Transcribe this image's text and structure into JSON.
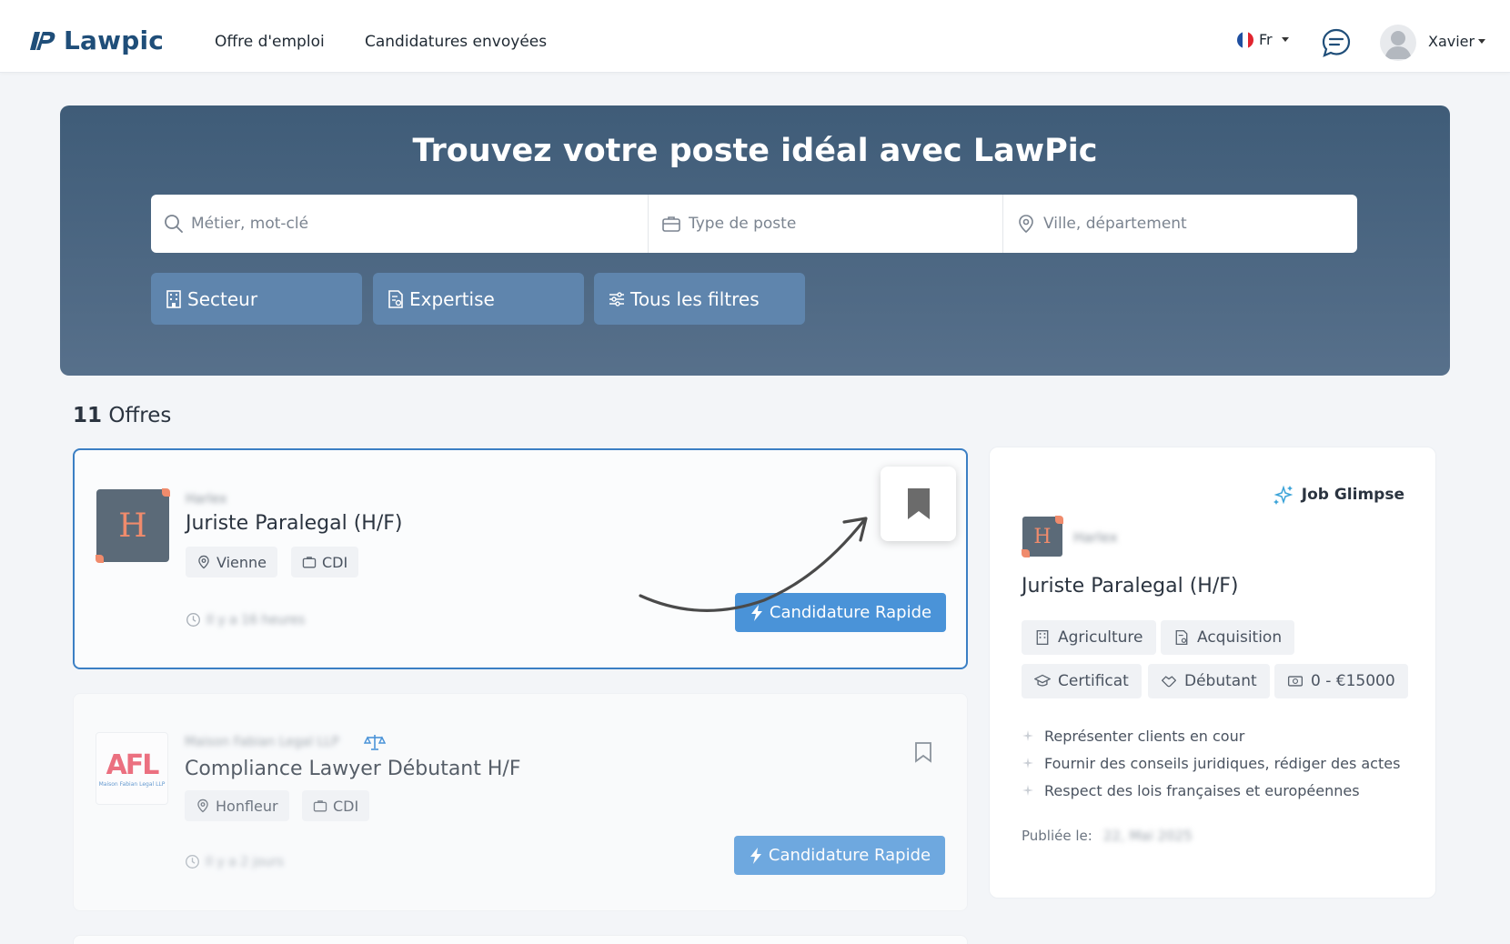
{
  "header": {
    "logo_text": "Lawpic",
    "nav": [
      "Offre d'emploi",
      "Candidatures envoyées"
    ],
    "language": "Fr",
    "username": "Xavier"
  },
  "hero": {
    "title": "Trouvez votre poste idéal avec LawPic",
    "search": {
      "keyword_placeholder": "Métier, mot-clé",
      "type_placeholder": "Type de poste",
      "location_placeholder": "Ville, département"
    },
    "filters": [
      "Secteur",
      "Expertise",
      "Tous les filtres"
    ]
  },
  "results": {
    "count": "11",
    "count_label": "Offres"
  },
  "jobs": [
    {
      "logo_letter": "H",
      "company": "Harlex",
      "title": "Juriste Paralegal (H/F)",
      "location": "Vienne",
      "contract": "CDI",
      "time": "Il y a 16 heures",
      "quick_apply": "Candidature Rapide"
    },
    {
      "logo_text": "AFL",
      "logo_sub": "Maison Fabian Legal LLP",
      "company": "Maison Fabian Legal LLP",
      "title": "Compliance Lawyer Débutant H/F",
      "location": "Honfleur",
      "contract": "CDI",
      "time": "Il y a 2 jours",
      "quick_apply": "Candidature Rapide"
    }
  ],
  "glimpse": {
    "heading": "Job Glimpse",
    "logo_letter": "H",
    "company": "Harlex",
    "title": "Juriste Paralegal (H/F)",
    "chips": {
      "sector": "Agriculture",
      "expertise": "Acquisition",
      "education": "Certificat",
      "level": "Débutant",
      "salary": "0 - €15000"
    },
    "bullets": [
      "Représenter clients en cour",
      "Fournir des conseils juridiques, rédiger des actes",
      "Respect des lois françaises et européennes"
    ],
    "published_label": "Publiée le:",
    "published_date": "22, Mai 2025"
  },
  "colors": {
    "brand": "#1f4e79",
    "hero_top": "#3f5c78",
    "filter_button": "#5f85ad",
    "quick_apply": "#4a93d8",
    "selected_border": "#3b7fc4",
    "logo_accent": "#f08b6c"
  }
}
